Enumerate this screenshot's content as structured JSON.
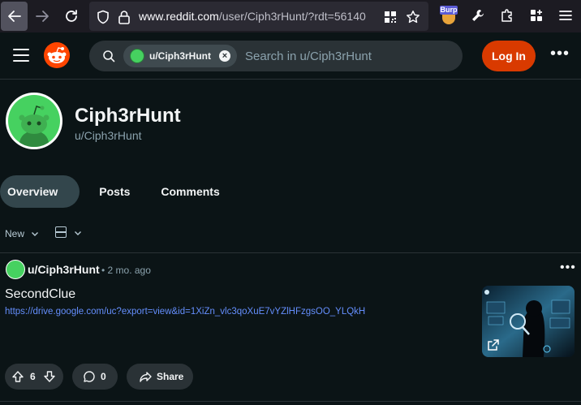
{
  "browser": {
    "url_main": "www.reddit.com",
    "url_rest": "/user/Ciph3rHunt/?rdt=56140",
    "extension_badge": "Burp"
  },
  "header": {
    "search_chip": "u/Ciph3rHunt",
    "search_placeholder": "Search in u/Ciph3rHunt",
    "login_label": "Log In"
  },
  "profile": {
    "display_name": "Ciph3rHunt",
    "username": "u/Ciph3rHunt"
  },
  "tabs": [
    {
      "label": "Overview",
      "active": true
    },
    {
      "label": "Posts",
      "active": false
    },
    {
      "label": "Comments",
      "active": false
    }
  ],
  "sort": {
    "label": "New"
  },
  "post": {
    "author": "u/Ciph3rHunt",
    "time": "• 2 mo. ago",
    "title": "SecondClue",
    "link": "https://drive.google.com/uc?export=view&id=1XiZn_vlc3qoXuE7vYZlHFzgsOO_YLQkH",
    "votes": "6",
    "comments": "0",
    "share_label": "Share"
  },
  "colors": {
    "accent": "#d93a00",
    "link": "#648efc",
    "background": "#0b1416"
  }
}
